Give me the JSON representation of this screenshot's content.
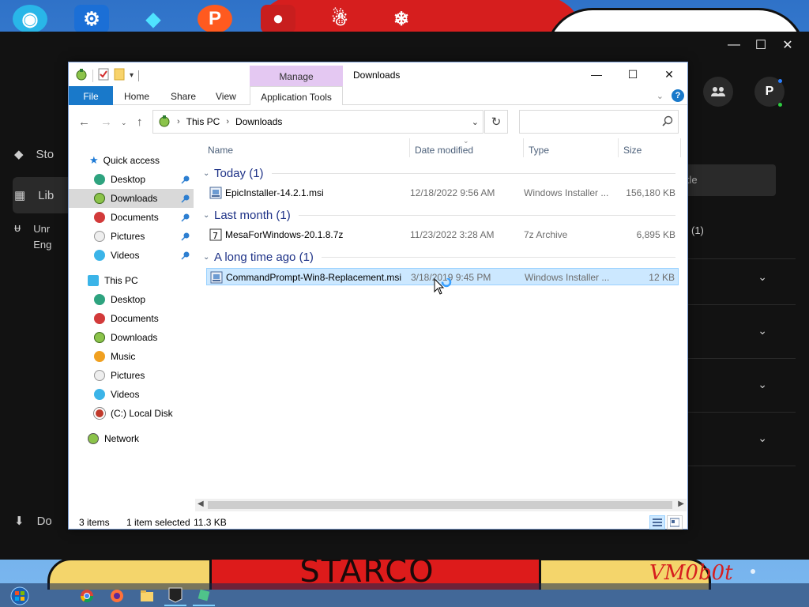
{
  "desktop": {
    "icons": [
      "app-icon",
      "gear-icon",
      "diamond-icon",
      "p-icon",
      "angry-bird-icon",
      "snowman-icon",
      "santa-icon"
    ],
    "art_text": "STARCO",
    "logo_text": "VM0b0t"
  },
  "taskbar": {
    "items": [
      "start-icon",
      "chrome-icon",
      "firefox-icon",
      "folder-icon",
      "epic-icon",
      "app-icon"
    ]
  },
  "launcher": {
    "nav": [
      "Sto",
      "Lib",
      "Unr",
      "Eng",
      "Do"
    ],
    "avatar_letter": "P",
    "filter_text": "itle",
    "row_text": "(1)"
  },
  "explorer": {
    "title": "Downloads",
    "manage_tab": "Manage",
    "ribbon_tabs": {
      "file": "File",
      "home": "Home",
      "share": "Share",
      "view": "View",
      "app_tools": "Application Tools"
    },
    "address": [
      "This PC",
      "Downloads"
    ],
    "search": {
      "placeholder": ""
    },
    "nav_pane": {
      "quick_access": "Quick access",
      "quick_items": [
        "Desktop",
        "Downloads",
        "Documents",
        "Pictures",
        "Videos"
      ],
      "this_pc": "This PC",
      "pc_items": [
        "Desktop",
        "Documents",
        "Downloads",
        "Music",
        "Pictures",
        "Videos",
        "(C:) Local Disk"
      ],
      "network": "Network"
    },
    "columns": [
      "Name",
      "Date modified",
      "Type",
      "Size"
    ],
    "groups": [
      {
        "label": "Today (1)",
        "files": [
          {
            "name": "EpicInstaller-14.2.1.msi",
            "date": "12/18/2022 9:56 AM",
            "type": "Windows Installer ...",
            "size": "156,180 KB"
          }
        ]
      },
      {
        "label": "Last month (1)",
        "files": [
          {
            "name": "MesaForWindows-20.1.8.7z",
            "date": "11/23/2022 3:28 AM",
            "type": "7z Archive",
            "size": "6,895 KB"
          }
        ]
      },
      {
        "label": "A long time ago (1)",
        "files": [
          {
            "name": "CommandPrompt-Win8-Replacement.msi",
            "date": "3/18/2019 9:45 PM",
            "type": "Windows Installer ...",
            "size": "12 KB"
          }
        ]
      }
    ],
    "status": {
      "items": "3 items",
      "selected": "1 item selected",
      "size": "11.3 KB"
    }
  },
  "colors": {
    "file_tab": "#1979ca",
    "manage_tab": "#e4c8f2",
    "selection": "#cce8ff",
    "group_label": "#1e3287"
  }
}
